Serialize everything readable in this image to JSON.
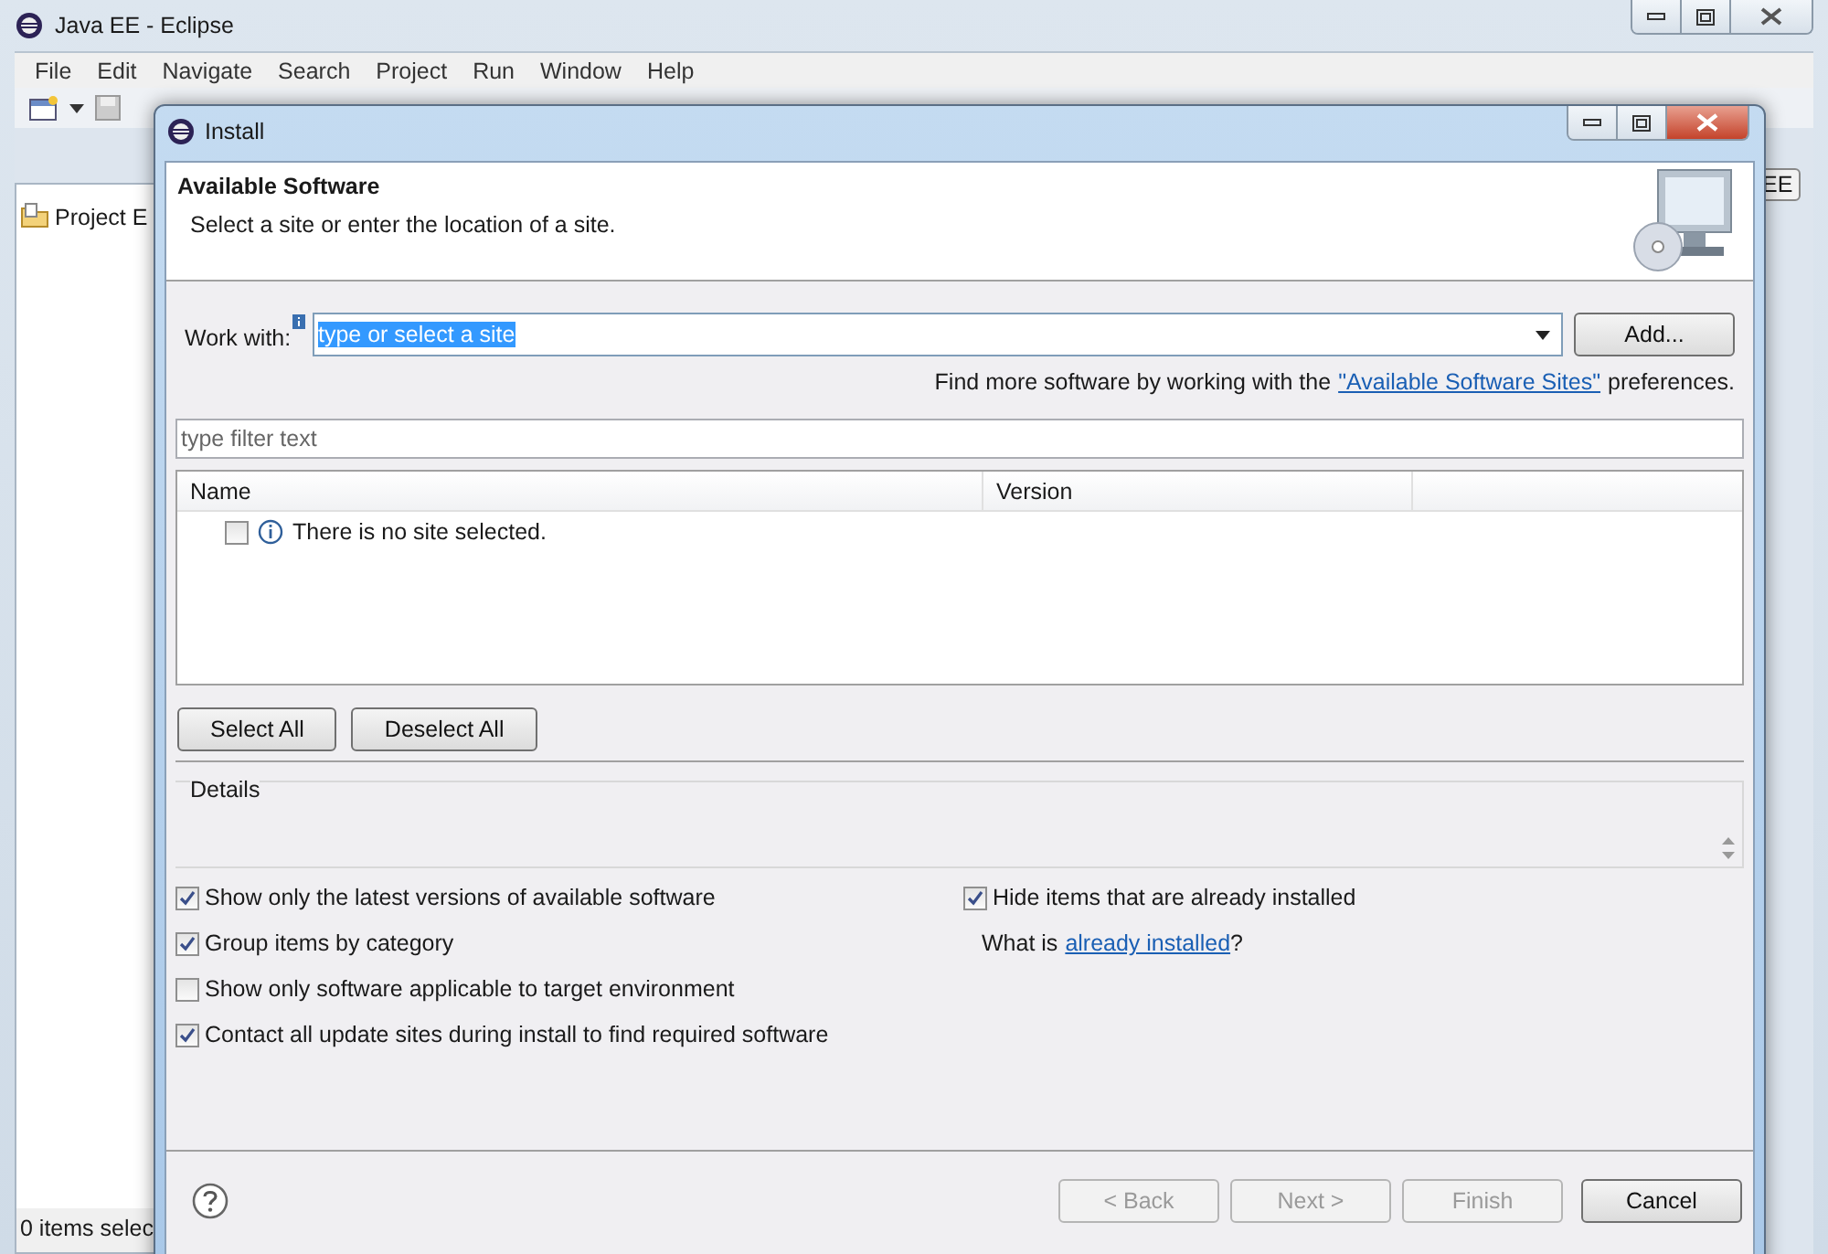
{
  "window": {
    "title": "Java EE - Eclipse"
  },
  "menu": [
    "File",
    "Edit",
    "Navigate",
    "Search",
    "Project",
    "Run",
    "Window",
    "Help"
  ],
  "project_explorer": {
    "title": "Project E"
  },
  "perspective": {
    "label": "EE"
  },
  "status_bar": {
    "text": "0 items selec"
  },
  "dialog": {
    "title": "Install",
    "heading": "Available Software",
    "subtitle": "Select a site or enter the location of a site.",
    "work_with": {
      "label": "Work with:",
      "value": "type or select a site",
      "highlighted": true
    },
    "add_button": "Add...",
    "hint": {
      "before": "Find more software by working with the",
      "link": "\"Available Software Sites\"",
      "after": "preferences."
    },
    "filter": {
      "placeholder": "type filter text"
    },
    "table": {
      "columns": [
        "Name",
        "Version"
      ],
      "rows": [
        {
          "text": "There is no site selected.",
          "checked": false
        }
      ]
    },
    "buttons": [
      "Select All",
      "Deselect All"
    ],
    "details": {
      "label": "Details"
    },
    "options": [
      {
        "label": "Show only the latest versions of available software",
        "checked": true
      },
      {
        "label": "Group items by category",
        "checked": true
      },
      {
        "label": "Show only software applicable to target environment",
        "checked": false
      },
      {
        "label": "Contact all update sites during install to find required software",
        "checked": true
      }
    ],
    "hide_installed": {
      "label": "Hide items that are already installed",
      "checked": true
    },
    "what_is": {
      "before": "What is",
      "link": "already installed",
      "after": "?"
    },
    "footer_buttons": [
      {
        "label": "< Back",
        "disabled": true
      },
      {
        "label": "Next >",
        "disabled": true
      },
      {
        "label": "Finish",
        "disabled": true
      },
      {
        "label": "Cancel",
        "disabled": false
      }
    ]
  }
}
